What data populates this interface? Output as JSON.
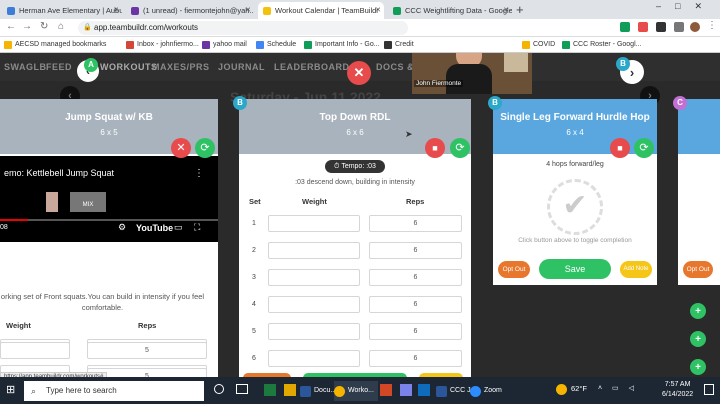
{
  "tabs": [
    {
      "label": "Herman Ave Elementary | Auburn",
      "color": "#3c7dd9"
    },
    {
      "label": "(1 unread) - fiermontejohn@yah...",
      "color": "#6b35a6"
    },
    {
      "label": "Workout Calendar | TeamBuildr",
      "color": "#f4c20d"
    },
    {
      "label": "CCC Weightlifting Data - Google S...",
      "color": "#0f9d58"
    }
  ],
  "url": "app.teambuildr.com/workouts",
  "bookmarks": [
    {
      "label": "AECSD managed bookmarks",
      "color": "#f4b400"
    },
    {
      "label": "Inbox - johnfiermo...",
      "color": "#d44638"
    },
    {
      "label": "yahoo mail",
      "color": "#6b35a6"
    },
    {
      "label": "Schedule",
      "color": "#4285f4"
    },
    {
      "label": "Important Info - Go...",
      "color": "#0f9d58"
    },
    {
      "label": "Credit",
      "color": "#333333"
    },
    {
      "label": "COVID",
      "color": "#f4b400"
    },
    {
      "label": "CCC Roster - Googl...",
      "color": "#0f9d58"
    }
  ],
  "nav": [
    "SWAGLB",
    "FEED",
    "WORKOUTS",
    "MAXES/PRS",
    "JOURNAL",
    "LEADERBOARD",
    "DOCS & LINKS"
  ],
  "date": "Saturday - Jun 11 2022",
  "zoom_name": "John Fiermonte",
  "card_left": {
    "letter": "A",
    "title": "Jump Squat w/ KB",
    "scheme": "6 x 5",
    "video_title": "emo: Kettlebell Jump Squat",
    "video_time": "08",
    "video_mix": "MIX",
    "youtube": "YouTube",
    "note": "orking set of Front squats.You can build in intensity if you feel comfortable.",
    "col_weight": "Weight",
    "col_reps": "Reps",
    "reps": [
      "5",
      "5",
      "5",
      "5"
    ]
  },
  "card_mid": {
    "letter": "B",
    "title": "Top Down RDL",
    "scheme": "6 x 6",
    "tempo": "Tempo: :03",
    "tempo_note": ":03 descend down, building in intensity",
    "col_set": "Set",
    "col_weight": "Weight",
    "col_reps": "Reps",
    "rows": [
      {
        "set": "1",
        "reps": "6"
      },
      {
        "set": "2",
        "reps": "6"
      },
      {
        "set": "3",
        "reps": "6"
      },
      {
        "set": "4",
        "reps": "6"
      },
      {
        "set": "5",
        "reps": "6"
      },
      {
        "set": "6",
        "reps": "6"
      }
    ]
  },
  "card_right": {
    "letter": "B",
    "title": "Single Leg Forward Hurdle Hop",
    "scheme": "6 x 4",
    "note": "4 hops forward/leg",
    "completion_text": "Click button above to toggle completion",
    "opt_out": "Opt Out",
    "save": "Save",
    "add_note": "Add Note"
  },
  "card_far": {
    "letter": "C",
    "opt_out": "Opt Out"
  },
  "status_url": "https://app.teambuildr.com/workouts#",
  "taskbar": {
    "search_placeholder": "Type here to search",
    "apps": [
      "Docu...",
      "Worko...",
      "CCC J...",
      "Zoom"
    ],
    "weather": "62°F",
    "time": "7:57 AM",
    "date": "6/14/2022"
  },
  "colors": {
    "accent_blue": "#5aa7e0",
    "head_gray": "#a8b3bd",
    "green": "#2ec265",
    "red": "#e84b4b",
    "orange": "#e8772e",
    "yellow": "#f5c518"
  }
}
